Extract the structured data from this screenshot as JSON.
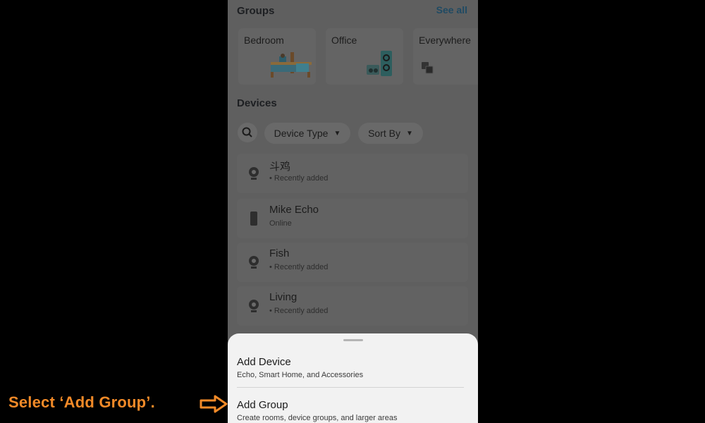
{
  "groups": {
    "title": "Groups",
    "see_all": "See all",
    "cards": [
      {
        "label": "Bedroom",
        "icon": "bed-icon"
      },
      {
        "label": "Office",
        "icon": "desk-speaker-icon"
      },
      {
        "label": "Everywhere",
        "icon": "multi-speaker-icon"
      }
    ]
  },
  "devices": {
    "title": "Devices",
    "filters": {
      "device_type": "Device Type",
      "sort_by": "Sort By"
    },
    "list": [
      {
        "name": "斗鸡",
        "status": "• Recently added",
        "icon": "camera-icon"
      },
      {
        "name": "Mike Echo",
        "status": "Online",
        "icon": "echo-speaker-icon"
      },
      {
        "name": "Fish",
        "status": "• Recently added",
        "icon": "camera-icon"
      },
      {
        "name": "Living",
        "status": "• Recently added",
        "icon": "camera-icon"
      }
    ]
  },
  "sheet": {
    "add_device": {
      "title": "Add Device",
      "subtitle": "Echo, Smart Home, and Accessories"
    },
    "add_group": {
      "title": "Add Group",
      "subtitle": "Create rooms, device groups, and larger areas"
    }
  },
  "annotation": {
    "text": "Select ‘Add Group’.",
    "color": "#f28a28"
  }
}
